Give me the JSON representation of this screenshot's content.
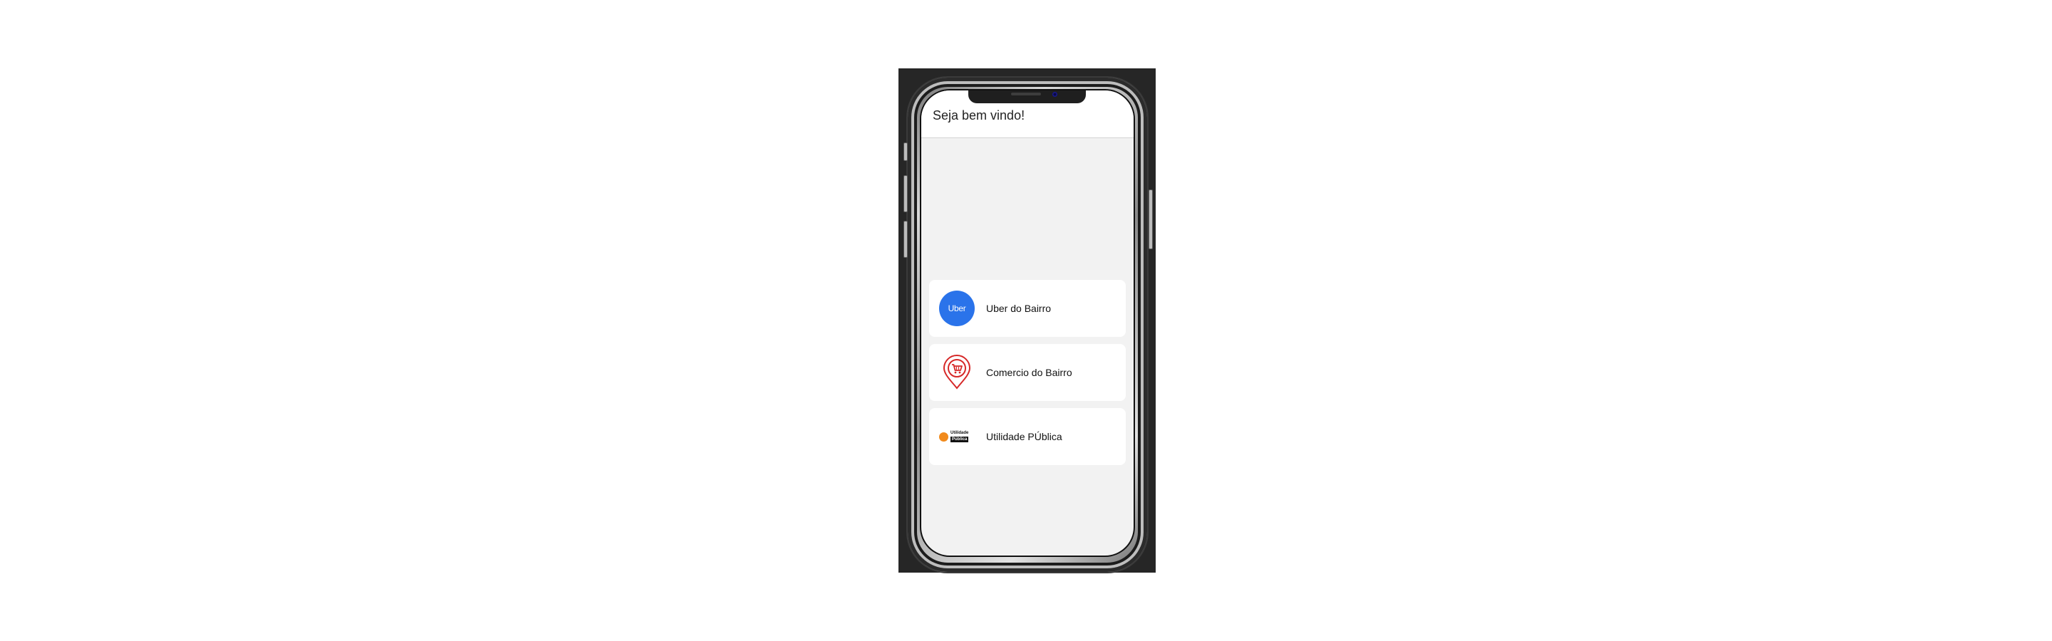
{
  "header": {
    "title": "Seja bem vindo!"
  },
  "menu": {
    "items": [
      {
        "label": "Uber do Bairro",
        "icon": "uber-icon",
        "icon_text": "Uber",
        "icon_color": "#2a73ea"
      },
      {
        "label": "Comercio do Bairro",
        "icon": "shop-pin-icon",
        "icon_color": "#d62828"
      },
      {
        "label": "Utilidade PÚblica",
        "icon": "utilidade-publica-icon",
        "logo_text": [
          "Utilidade",
          "Pública"
        ],
        "icon_color": "#f18a1c"
      }
    ]
  },
  "colors": {
    "screen_background": "#f2f2f2",
    "header_background": "#ffffff",
    "card_background": "#ffffff",
    "device_background": "#262626"
  }
}
